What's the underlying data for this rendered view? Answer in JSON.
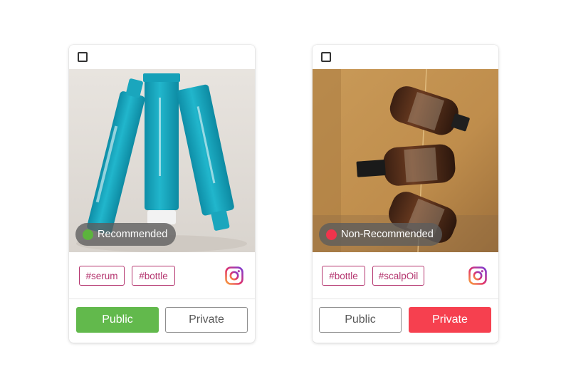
{
  "cards": [
    {
      "status_label": "Recommended",
      "status_color": "#5cb43d",
      "tags": [
        "#serum",
        "#bottle"
      ],
      "platform_icon": "instagram-icon",
      "visibility": {
        "public_label": "Public",
        "private_label": "Private",
        "selected": "Public"
      },
      "selected_color": "#62b94c"
    },
    {
      "status_label": "Non-Recommended",
      "status_color": "#f0344c",
      "tags": [
        "#bottle",
        "#scalpOil"
      ],
      "platform_icon": "instagram-icon",
      "visibility": {
        "public_label": "Public",
        "private_label": "Private",
        "selected": "Private"
      },
      "selected_color": "#f6404f"
    }
  ],
  "colors": {
    "tag_color": "#b4346e",
    "badge_bg": "#5c5c5c"
  }
}
